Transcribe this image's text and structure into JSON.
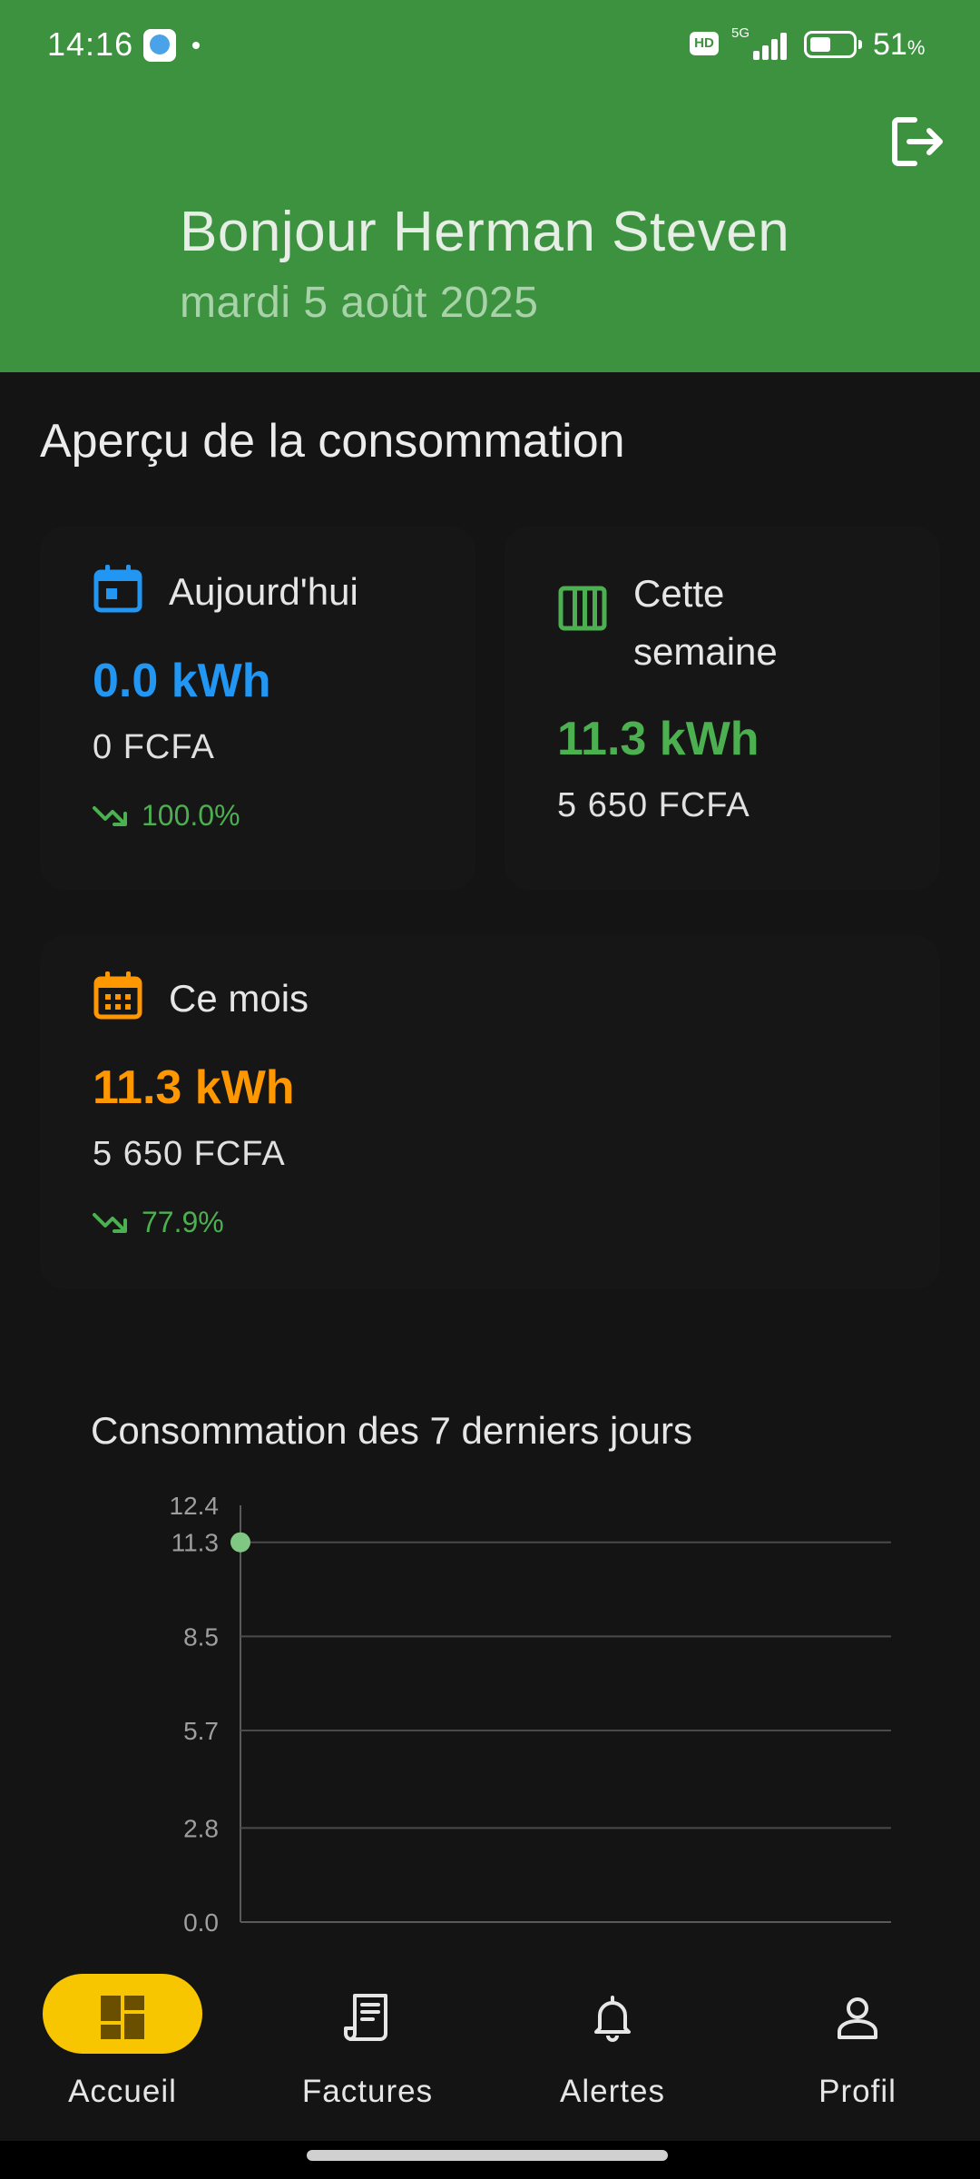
{
  "status_bar": {
    "time": "14:16",
    "hd": "HD",
    "network": "5G",
    "battery_text": "51",
    "battery_unit": "%",
    "battery_level": 0.51
  },
  "header": {
    "greeting": "Bonjour Herman Steven",
    "date": "mardi 5 août 2025",
    "bg_color": "#3d9240",
    "logout_icon": "logout-icon"
  },
  "overview": {
    "title": "Aperçu de la consommation",
    "cards": [
      {
        "label": "Aujourd'hui",
        "value": "0.0 kWh",
        "cost": "0 FCFA",
        "trend": "100.0%",
        "icon": "calendar-today-icon",
        "color": "#2196f3"
      },
      {
        "label_line1": "Cette",
        "label_line2": "semaine",
        "value": "11.3 kWh",
        "cost": "5 650 FCFA",
        "icon": "calendar-week-icon",
        "color": "#4caf50"
      },
      {
        "label": "Ce mois",
        "value": "11.3 kWh",
        "cost": "5 650 FCFA",
        "trend": "77.9%",
        "icon": "calendar-month-icon",
        "color": "#ff9800"
      }
    ],
    "trend_color": "#4caf50"
  },
  "chart": {
    "title": "Consommation des 7 derniers jours"
  },
  "chart_data": {
    "type": "line",
    "title": "Consommation des 7 derniers jours",
    "xlabel": "",
    "ylabel": "",
    "y_ticks": [
      "0.0",
      "2.8",
      "5.7",
      "8.5",
      "11.3",
      "12.4"
    ],
    "ylim": [
      0,
      12.4
    ],
    "grid": true,
    "series": [
      {
        "points": [
          {
            "x": 0,
            "y": 11.3
          }
        ],
        "color": "#81c784"
      }
    ]
  },
  "bottom_nav": {
    "items": [
      {
        "label": "Accueil",
        "icon": "dashboard-icon",
        "active": true
      },
      {
        "label": "Factures",
        "icon": "receipt-icon",
        "active": false
      },
      {
        "label": "Alertes",
        "icon": "bell-icon",
        "active": false
      },
      {
        "label": "Profil",
        "icon": "person-icon",
        "active": false
      }
    ],
    "active_color": "#f7c600"
  }
}
